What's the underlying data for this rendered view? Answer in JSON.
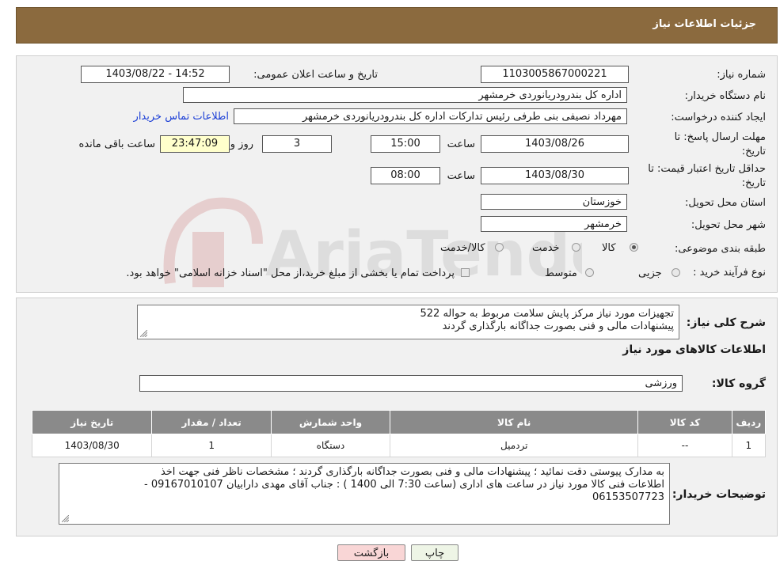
{
  "header": {
    "title": "جزئیات اطلاعات نیاز"
  },
  "form": {
    "need_number": {
      "label": "شماره نیاز:",
      "value": "1103005867000221"
    },
    "announce_datetime": {
      "label": "تاریخ و ساعت اعلان عمومی:",
      "value": "1403/08/22 - 14:52"
    },
    "buyer_org": {
      "label": "نام دستگاه خریدار:",
      "value": "اداره کل بندرودریانوردی خرمشهر"
    },
    "requester": {
      "label": "ایجاد کننده درخواست:",
      "value": "مهرداد  نصیفی بنی طرفی رئیس تدارکات اداره کل بندرودریانوردی خرمشهر",
      "contact_link": "اطلاعات تماس خریدار"
    },
    "reply_deadline": {
      "label_line1": "مهلت ارسال پاسخ: تا",
      "label_line2": "تاریخ:",
      "date": "1403/08/26",
      "time_label": "ساعت",
      "time": "15:00",
      "days": "3",
      "days_label": "روز و",
      "remaining": "23:47:09",
      "remaining_label": "ساعت باقی مانده"
    },
    "price_validity": {
      "label_line1": "حداقل تاریخ اعتبار قیمت: تا",
      "label_line2": "تاریخ:",
      "date": "1403/08/30",
      "time_label": "ساعت",
      "time": "08:00"
    },
    "delivery_province": {
      "label": "استان محل تحویل:",
      "value": "خوزستان"
    },
    "delivery_city": {
      "label": "شهر محل تحویل:",
      "value": "خرمشهر"
    },
    "category": {
      "label": "طبقه بندی موضوعی:",
      "options": [
        "کالا",
        "خدمت",
        "کالا/خدمت"
      ],
      "selected": "کالا"
    },
    "process_type": {
      "label": "نوع فرآیند خرید :",
      "options": [
        "جزیی",
        "متوسط"
      ],
      "note": "پرداخت تمام یا بخشی از مبلغ خرید،از محل \"اسناد خزانه اسلامی\" خواهد بود."
    }
  },
  "description": {
    "label": "شرح کلی نیاز:",
    "line1": "تجهیزات مورد نیاز مرکز پایش سلامت مربوط به حواله 522",
    "line2": "پیشنهادات مالی و فنی بصورت جداگانه بارگذاری گردند"
  },
  "goods": {
    "section_title": "اطلاعات کالاهای مورد نیاز",
    "group_label": "گروه کالا:",
    "group_value": "ورزشی",
    "columns": [
      "ردیف",
      "کد کالا",
      "نام کالا",
      "واحد شمارش",
      "تعداد / مقدار",
      "تاریخ نیاز"
    ],
    "rows": [
      [
        "1",
        "--",
        "تردمیل",
        "دستگاه",
        "1",
        "1403/08/30"
      ]
    ]
  },
  "buyer_notes": {
    "label": "توضیحات خریدار:",
    "line1": "به مدارک پیوستی دقت نمائید ؛ پیشنهادات مالی و فنی بصورت جداگانه بارگذاری گردند ؛ مشخصات ناظر فنی جهت اخذ",
    "line2": "اطلاعات فنی کالا مورد نیاز در ساعت های اداری (ساعت 7:30 الی 1400 ) : جناب آقای مهدی دارابیان  09167010107 -",
    "line3": "06153507723"
  },
  "buttons": {
    "print": "چاپ",
    "back": "بازگشت"
  },
  "watermark": {
    "text": "AriaTender.neT"
  },
  "colors": {
    "header_bg": "#8b6a3e",
    "table_header_bg": "#8a8a8a",
    "remaining_bg": "#ffffcc",
    "back_button_bg": "#f9d6d6",
    "link": "#1c3fd6"
  }
}
